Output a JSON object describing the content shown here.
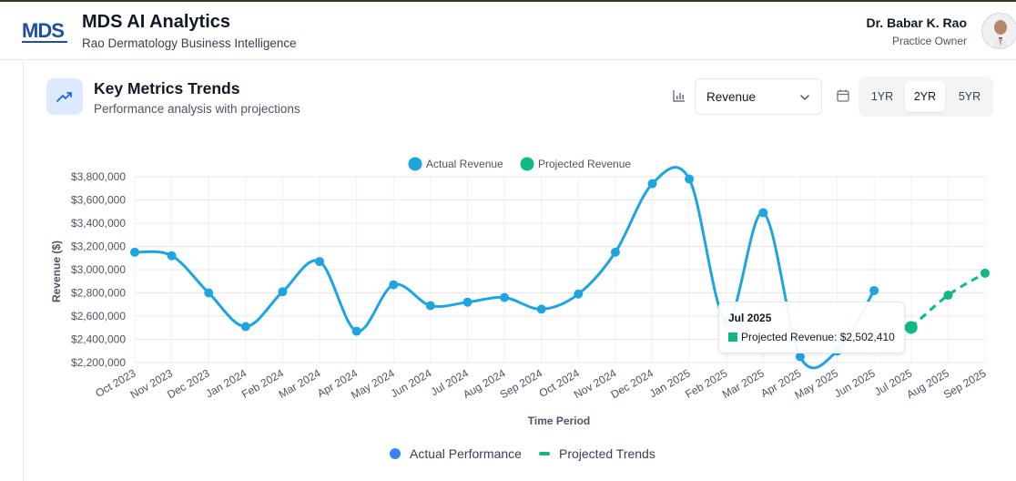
{
  "header": {
    "logo_text": "MDS",
    "app_title": "MDS AI Analytics",
    "app_subtitle": "Rao Dermatology Business Intelligence",
    "user_name": "Dr. Babar K. Rao",
    "user_role": "Practice Owner"
  },
  "card": {
    "icon": "trending-up-icon",
    "title": "Key Metrics Trends",
    "subtitle": "Performance analysis with projections"
  },
  "controls": {
    "metric_select": {
      "value": "Revenue"
    },
    "period_tabs": [
      {
        "label": "1YR",
        "active": false
      },
      {
        "label": "2YR",
        "active": true
      },
      {
        "label": "5YR",
        "active": false
      }
    ]
  },
  "tooltip": {
    "title": "Jul 2025",
    "label": "Projected Revenue: $2,502,410"
  },
  "bottom_legend": {
    "actual": "Actual Performance",
    "projected": "Projected Trends"
  },
  "colors": {
    "actual": "#1ea5e0",
    "projected": "#10b981",
    "accent": "#3b82f6"
  },
  "chart_data": {
    "type": "line",
    "x": [
      "Oct 2023",
      "Nov 2023",
      "Dec 2023",
      "Jan 2024",
      "Feb 2024",
      "Mar 2024",
      "Apr 2024",
      "May 2024",
      "Jun 2024",
      "Jul 2024",
      "Aug 2024",
      "Sep 2024",
      "Oct 2024",
      "Nov 2024",
      "Dec 2024",
      "Jan 2025",
      "Feb 2025",
      "Mar 2025",
      "Apr 2025",
      "May 2025",
      "Jun 2025",
      "Jul 2025",
      "Aug 2025",
      "Sep 2025"
    ],
    "series": [
      {
        "name": "Actual Revenue",
        "values": [
          3150000,
          3120000,
          2800000,
          2510000,
          2810000,
          3070000,
          2470000,
          2870000,
          2690000,
          2720000,
          2760000,
          2660000,
          2790000,
          3150000,
          3740000,
          3780000,
          2560000,
          3490000,
          2250000,
          2300000,
          2820000,
          null,
          null,
          null
        ]
      },
      {
        "name": "Projected Revenue",
        "values": [
          null,
          null,
          null,
          null,
          null,
          null,
          null,
          null,
          null,
          null,
          null,
          null,
          null,
          null,
          null,
          null,
          null,
          null,
          null,
          null,
          null,
          2502410,
          2780000,
          2970000
        ]
      }
    ],
    "ylabel": "Revenue ($)",
    "xlabel": "Time Period",
    "yticks": [
      "$2,200,000",
      "$2,400,000",
      "$2,600,000",
      "$2,800,000",
      "$3,000,000",
      "$3,200,000",
      "$3,400,000",
      "$3,600,000",
      "$3,800,000"
    ],
    "ylim": [
      2200000,
      3800000
    ],
    "grid": true,
    "legend": "top"
  }
}
